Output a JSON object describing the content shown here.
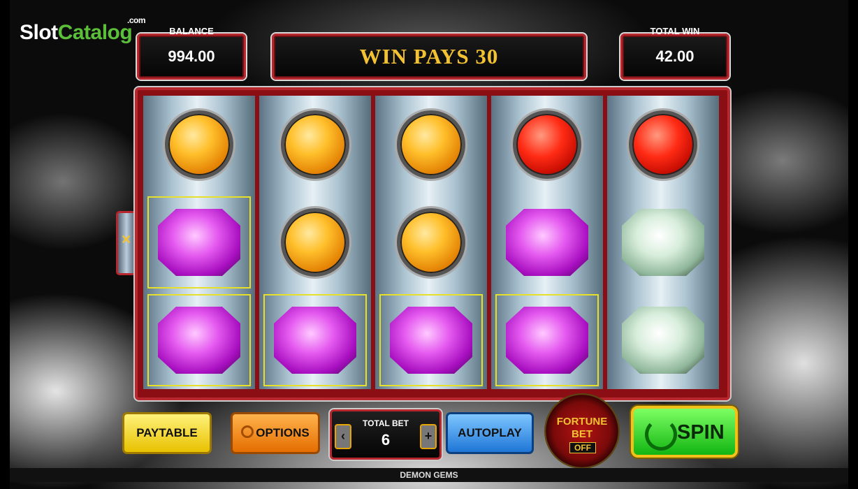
{
  "logo": {
    "part1": "Slot",
    "part2": "Catalog",
    "suffix": ".com"
  },
  "balance": {
    "label": "BALANCE",
    "value": "994.00"
  },
  "win_message": "WIN PAYS 30",
  "total_win": {
    "label": "TOTAL WIN",
    "value": "42.00"
  },
  "side_tab": {
    "icon": "winged-symbol-icon"
  },
  "reels": [
    [
      "orange",
      "purple",
      "purple"
    ],
    [
      "orange",
      "orange",
      "purple"
    ],
    [
      "orange",
      "orange",
      "purple"
    ],
    [
      "red",
      "purple",
      "purple"
    ],
    [
      "red",
      "white",
      "white"
    ]
  ],
  "winning_cells": [
    [
      0,
      1
    ],
    [
      0,
      2
    ],
    [
      1,
      2
    ],
    [
      2,
      2
    ],
    [
      3,
      2
    ]
  ],
  "buttons": {
    "paytable": "PAYTABLE",
    "options": "OPTIONS",
    "autoplay": "AUTOPLAY",
    "spin": "SPIN"
  },
  "total_bet": {
    "label": "TOTAL BET",
    "value": "6",
    "decrease": "‹",
    "increase": "+"
  },
  "fortune_bet": {
    "line1": "FORTUNE",
    "line2": "BET",
    "state": "OFF"
  },
  "game_name": "DEMON GEMS",
  "colors": {
    "frame": "#b8262e",
    "gold": "#f3c233",
    "win_highlight": "#e6e02a"
  }
}
